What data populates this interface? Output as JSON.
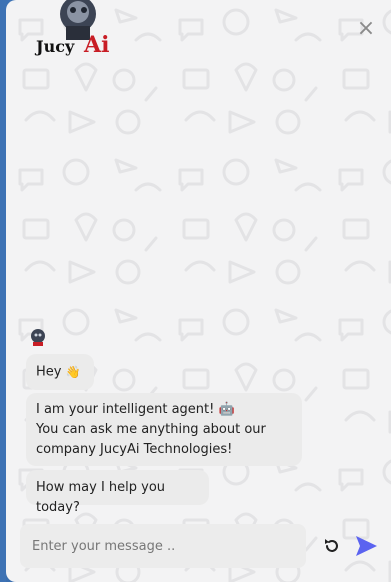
{
  "header": {
    "logo_text": "JucyAi",
    "close_label": "×"
  },
  "messages": [
    {
      "text": "Hey",
      "emoji": "👋"
    },
    {
      "lines": [
        "I am your intelligent agent! 🤖",
        "You can ask me anything about our",
        "company JucyAi Technologies!"
      ]
    },
    {
      "text": "How may I help you today?"
    }
  ],
  "composer": {
    "placeholder": "Enter your message .."
  },
  "colors": {
    "accent": "#5b63f0",
    "bubble": "#ebebeb",
    "background": "#f3f3f4"
  },
  "icons": {
    "reset": "refresh-icon",
    "send": "send-icon",
    "close": "close-icon"
  }
}
